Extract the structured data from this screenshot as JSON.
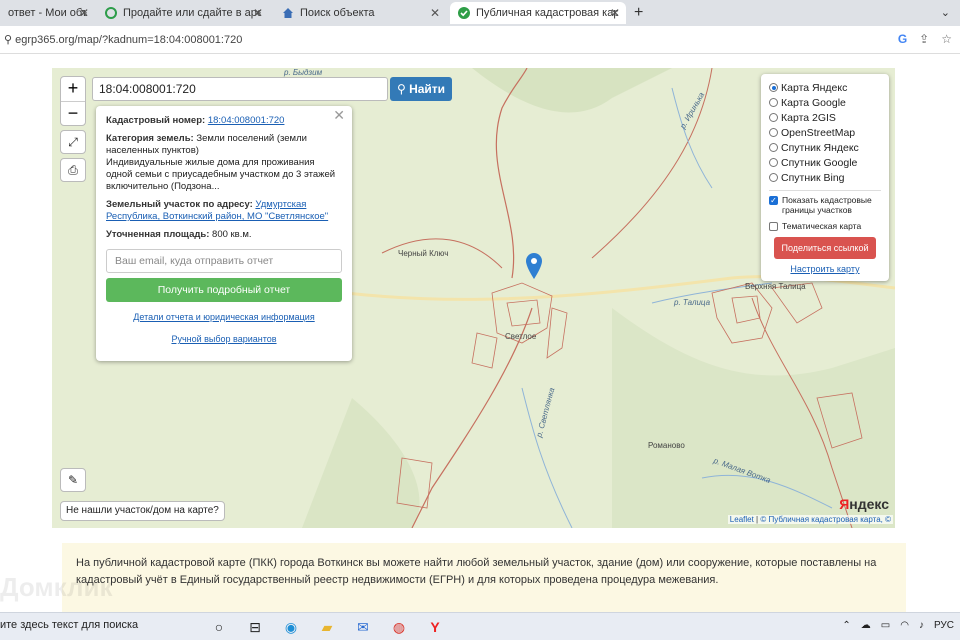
{
  "browser": {
    "tabs": [
      {
        "label": "ответ - Мои объявл",
        "active": false
      },
      {
        "label": "Продайте или сдайте в аренду",
        "active": false
      },
      {
        "label": "Поиск объекта",
        "active": false
      },
      {
        "label": "Публичная кадастровая карта",
        "active": true
      }
    ],
    "new_tab": "+",
    "url": "egrp365.org/map/?kadnum=18:04:008001:720"
  },
  "map": {
    "search_value": "18:04:008001:720",
    "find_button": "Найти",
    "zoom_in": "+",
    "zoom_out": "−",
    "popup": {
      "cad_label": "Кадастровый номер:",
      "cad_value": "18:04:008001:720",
      "category_label": "Категория земель:",
      "category_value": "Земли поселений (земли населенных пунктов)",
      "usage": "Индивидуальные жилые дома для проживания одной семьи с приусадебным участком до 3 этажей включительно (Подзона...",
      "address_label": "Земельный участок по адресу:",
      "address_value": "Удмуртская Республика, Воткинский район, МО \"Светлянское\"",
      "area_label": "Уточненная площадь:",
      "area_value": "800 кв.м.",
      "email_placeholder": "Ваш email, куда отправить отчет",
      "report_button": "Получить подробный отчет",
      "details_link": "Детали отчета и юридическая информация",
      "manual_link": "Ручной выбор вариантов"
    },
    "layers": {
      "options": [
        "Карта Яндекс",
        "Карта Google",
        "Карта 2GIS",
        "OpenStreetMap",
        "Спутник Яндекс",
        "Спутник Google",
        "Спутник Bing"
      ],
      "selected": "Карта Яндекс",
      "show_borders": "Показать кадастровые границы участков",
      "thematic": "Тематическая карта",
      "share_button": "Поделиться ссылкой",
      "configure_link": "Настроить карту"
    },
    "not_found": "Не нашли участок/дом на карте?",
    "place_labels": {
      "chernyi_kluch": "Черный Ключ",
      "svetloe": "Светлое",
      "verkhnyaya_talitsa": "Верхняя Талица",
      "romanovo": "Романово",
      "r_irinka": "р. Иринька",
      "r_talitsa": "р. Талица",
      "r_svetlyanka": "р. Светлянка",
      "r_malaya_votka": "р. Малая Вотка",
      "r_bydzim": "р. Быдзим"
    },
    "yandex_logo": "Яндекс",
    "attribution_leaflet": "Leaflet",
    "attribution_pkk": "© Публичная кадастровая карта, ©"
  },
  "info_text": "На публичной кадастровой карте (ПКК) города Воткинск вы можете найти любой земельный участок, здание (дом) или сооружение, которые поставлены на кадастровый учёт в Единый государственный реестр недвижимости (ЕГРН) и для которых проведена процедура межевания.",
  "watermark": "Домклик",
  "taskbar": {
    "search": "ите здесь текст для поиска",
    "lang": "РУС"
  }
}
